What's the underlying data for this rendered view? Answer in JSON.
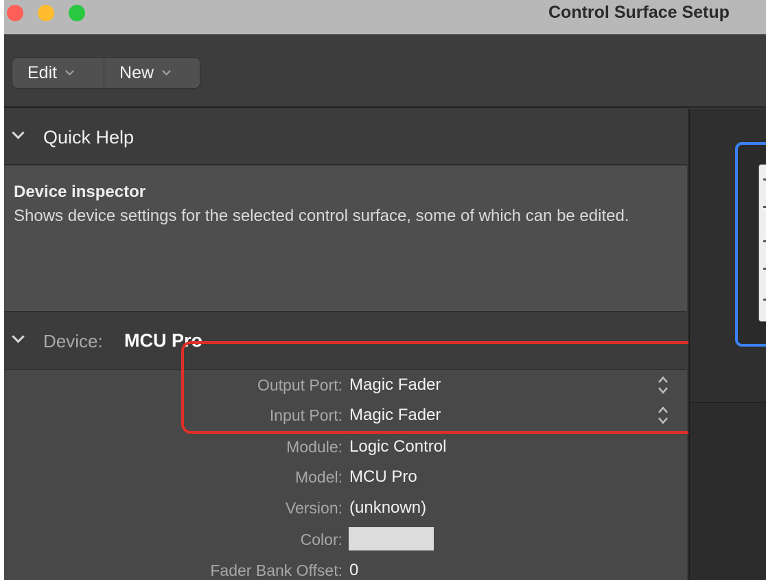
{
  "window": {
    "title": "Control Surface Setup"
  },
  "toolbar": {
    "edit_label": "Edit",
    "new_label": "New"
  },
  "quick_help": {
    "header": "Quick Help",
    "title": "Device inspector",
    "body": "Shows device settings for the selected control surface, some of which can be edited."
  },
  "device": {
    "header_label": "Device:",
    "name": "MCU Pro",
    "properties": {
      "output_port": {
        "label": "Output Port:",
        "value": "Magic Fader"
      },
      "input_port": {
        "label": "Input Port:",
        "value": "Magic Fader"
      },
      "module": {
        "label": "Module:",
        "value": "Logic Control"
      },
      "model": {
        "label": "Model:",
        "value": "MCU Pro"
      },
      "version": {
        "label": "Version:",
        "value": "(unknown)"
      },
      "color": {
        "label": "Color:",
        "swatch": "#dcdcdc"
      },
      "fader_bank_offset": {
        "label": "Fader Bank Offset:",
        "value": "0"
      }
    }
  },
  "colors": {
    "highlight": "#e02f26",
    "selection": "#3a82f6"
  }
}
